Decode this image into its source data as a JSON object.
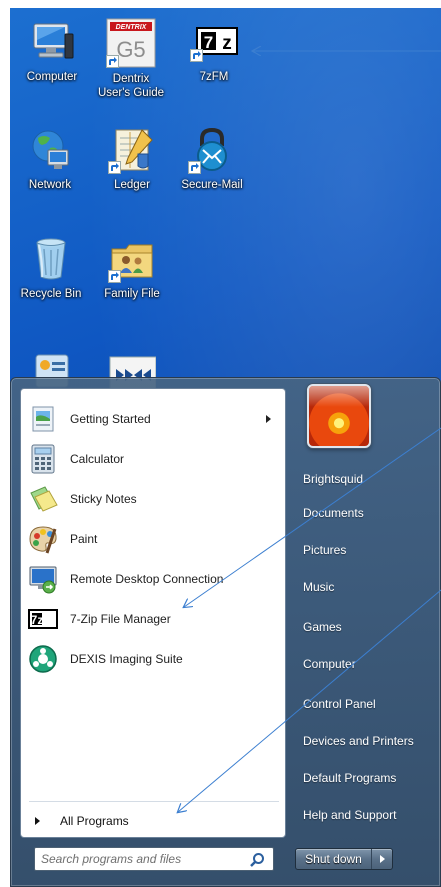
{
  "desktop": {
    "icons": [
      {
        "name": "desktop-icon-computer",
        "label": "Computer",
        "icon": "computer-icon"
      },
      {
        "name": "desktop-icon-dentrix-guide",
        "label": "Dentrix User's Guide",
        "icon": "dentrix-g5-icon"
      },
      {
        "name": "desktop-icon-7zfm",
        "label": "7zFM",
        "icon": "7zip-icon"
      },
      {
        "name": "desktop-icon-network",
        "label": "Network",
        "icon": "network-globe-icon"
      },
      {
        "name": "desktop-icon-ledger",
        "label": "Ledger",
        "icon": "ledger-icon"
      },
      {
        "name": "desktop-icon-secure-mail",
        "label": "Secure-Mail",
        "icon": "padlock-mail-icon"
      },
      {
        "name": "desktop-icon-recycle-bin",
        "label": "Recycle Bin",
        "icon": "recycle-bin-icon"
      },
      {
        "name": "desktop-icon-family-file",
        "label": "Family File",
        "icon": "family-file-icon"
      }
    ],
    "dentrix_logo_text": "DENTRIX",
    "dentrix_g5_text": "G5",
    "seven_zip_text": "7z"
  },
  "start_menu": {
    "programs": [
      {
        "label": "Getting Started",
        "icon": "getting-started-icon",
        "has_submenu": true
      },
      {
        "label": "Calculator",
        "icon": "calculator-icon"
      },
      {
        "label": "Sticky Notes",
        "icon": "sticky-notes-icon"
      },
      {
        "label": "Paint",
        "icon": "paint-palette-icon"
      },
      {
        "label": "Remote Desktop Connection",
        "icon": "remote-desktop-icon"
      },
      {
        "label": "7-Zip File Manager",
        "icon": "7zip-icon"
      },
      {
        "label": "DEXIS Imaging Suite",
        "icon": "dexis-icon"
      }
    ],
    "all_programs": "All Programs",
    "search_placeholder": "Search programs and files",
    "right_items": [
      "Brightsquid",
      "Documents",
      "Pictures",
      "Music",
      "Games",
      "Computer",
      "Control Panel",
      "Devices and Printers",
      "Default Programs",
      "Help and Support"
    ],
    "shutdown_label": "Shut down"
  },
  "colors": {
    "desktop_blue": "#0f57c2",
    "annotation_arrow": "#3c7fd0",
    "start_menu_glass": "#4a6784"
  }
}
